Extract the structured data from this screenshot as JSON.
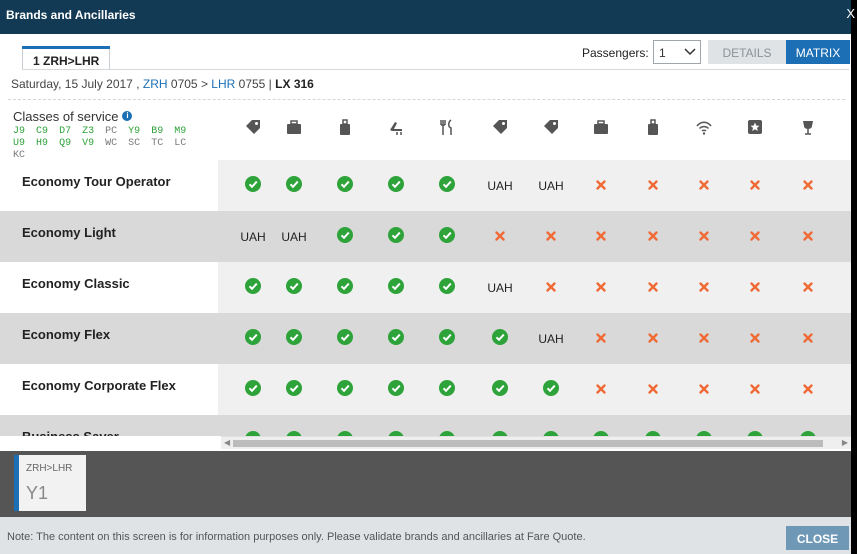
{
  "dialog": {
    "title": "Brands and Ancillaries",
    "close_glyph": "X"
  },
  "segment_tab": "1 ZRH>LHR",
  "passengers": {
    "label": "Passengers:",
    "value": "1"
  },
  "view_buttons": {
    "details": "DETAILS",
    "matrix": "MATRIX"
  },
  "flight": {
    "date": "Saturday, 15 July 2017 ,",
    "origin": "ZRH",
    "dep_time": "0705",
    "arrow": ">",
    "dest": "LHR",
    "arr_time": "0755 |",
    "flight_no": "LX 316"
  },
  "classes": {
    "title": "Classes of service",
    "info_icon": "info-icon",
    "codes": [
      {
        "c": "J9",
        "s": "available"
      },
      {
        "c": "C9",
        "s": "available"
      },
      {
        "c": "D7",
        "s": "available"
      },
      {
        "c": "Z3",
        "s": "available"
      },
      {
        "c": "PC",
        "s": "unavailable"
      },
      {
        "c": "Y9",
        "s": "available"
      },
      {
        "c": "B9",
        "s": "available"
      },
      {
        "c": "M9",
        "s": "available"
      },
      {
        "c": "U9",
        "s": "available"
      },
      {
        "c": "H9",
        "s": "available"
      },
      {
        "c": "Q9",
        "s": "available"
      },
      {
        "c": "V9",
        "s": "available"
      },
      {
        "c": "WC",
        "s": "unavailable"
      },
      {
        "c": "SC",
        "s": "unavailable"
      },
      {
        "c": "TC",
        "s": "unavailable"
      },
      {
        "c": "LC",
        "s": "unavailable"
      },
      {
        "c": "KC",
        "s": "unavailable"
      }
    ]
  },
  "colors": {
    "included": "#2ea33a",
    "not_offered": "#f06a35",
    "accent": "#1c6fb5",
    "titlebar": "#123a55"
  },
  "ancillary_icons": [
    "tag-icon",
    "briefcase-icon",
    "cabin-bag-icon",
    "seat-icon",
    "meal-icon",
    "tag-icon",
    "tag-icon",
    "briefcase-icon",
    "cabin-bag-icon",
    "wifi-icon",
    "star-icon",
    "lounge-icon"
  ],
  "brands": [
    {
      "name": "Economy Tour Operator",
      "cells": [
        "ok",
        "ok",
        "ok",
        "ok",
        "ok",
        "UAH",
        "UAH",
        "no",
        "no",
        "no",
        "no",
        "no"
      ]
    },
    {
      "name": "Economy Light",
      "cells": [
        "UAH",
        "UAH",
        "ok",
        "ok",
        "ok",
        "no",
        "no",
        "no",
        "no",
        "no",
        "no",
        "no"
      ]
    },
    {
      "name": "Economy Classic",
      "cells": [
        "ok",
        "ok",
        "ok",
        "ok",
        "ok",
        "UAH",
        "no",
        "no",
        "no",
        "no",
        "no",
        "no"
      ]
    },
    {
      "name": "Economy Flex",
      "cells": [
        "ok",
        "ok",
        "ok",
        "ok",
        "ok",
        "ok",
        "UAH",
        "no",
        "no",
        "no",
        "no",
        "no"
      ]
    },
    {
      "name": "Economy Corporate Flex",
      "cells": [
        "ok",
        "ok",
        "ok",
        "ok",
        "ok",
        "ok",
        "ok",
        "no",
        "no",
        "no",
        "no",
        "no"
      ]
    },
    {
      "name": "Business Saver",
      "cells": [
        "ok",
        "ok",
        "ok",
        "ok",
        "ok",
        "ok",
        "ok",
        "ok",
        "ok",
        "ok",
        "ok",
        "ok"
      ]
    }
  ],
  "selected_segment": {
    "route": "ZRH>LHR",
    "fare_class": "Y1"
  },
  "footer": {
    "note": "Note: The content on this screen is for information purposes only. Please validate brands and ancillaries at Fare Quote.",
    "close": "CLOSE"
  }
}
